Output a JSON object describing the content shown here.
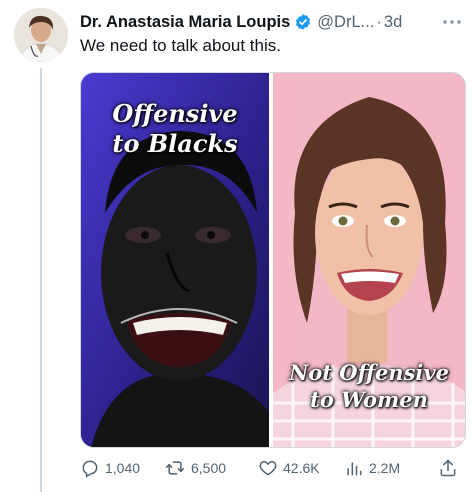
{
  "tweet": {
    "author_name": "Dr. Anastasia Maria Loupis",
    "handle": "@DrL...",
    "separator": "·",
    "time": "3d",
    "text": "We need to talk about this."
  },
  "media": {
    "left_caption_line1": "Offensive",
    "left_caption_line2": "to Blacks",
    "right_caption_line1": "Not Offensive",
    "right_caption_line2": "to Women"
  },
  "actions": {
    "replies": "1,040",
    "reposts": "6,500",
    "likes": "42.6K",
    "views": "2.2M"
  },
  "colors": {
    "verified": "#1d9bf0",
    "text": "#0f1419",
    "muted": "#536471"
  },
  "icons": [
    "verified-badge-icon",
    "more-icon",
    "reply-icon",
    "repost-icon",
    "like-icon",
    "views-icon",
    "share-icon"
  ]
}
